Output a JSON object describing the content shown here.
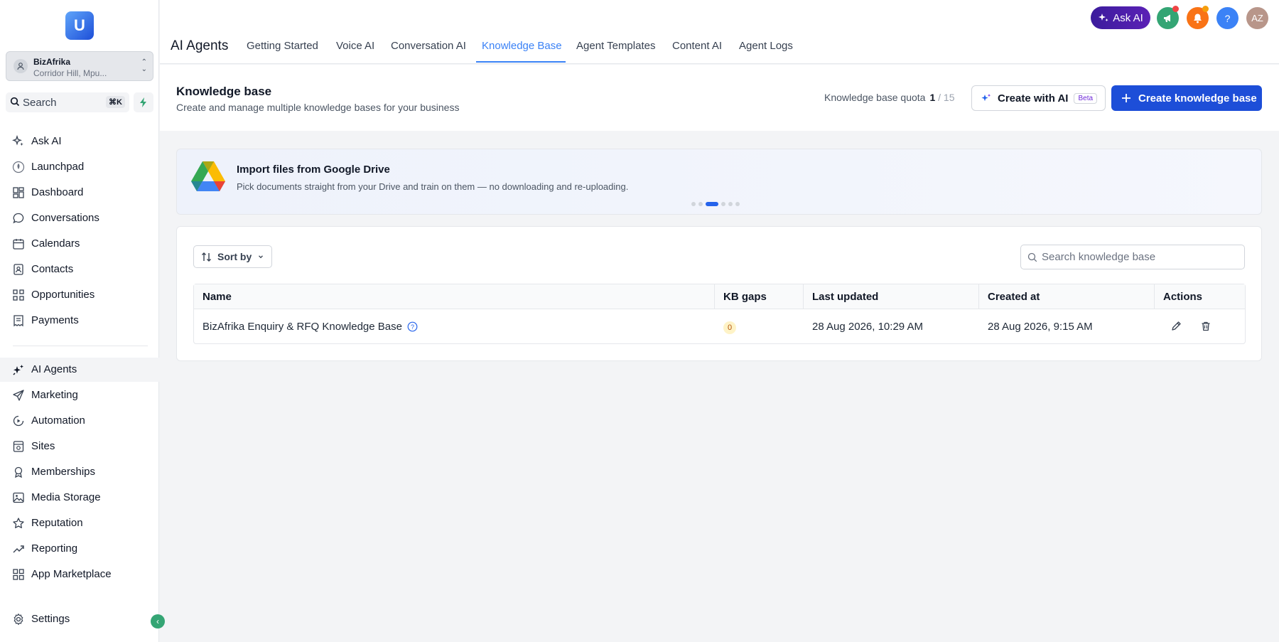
{
  "sidebar": {
    "logo_letter": "U",
    "account": {
      "name": "BizAfrika",
      "location": "Corridor Hill, Mpu..."
    },
    "search": {
      "label": "Search",
      "shortcut": "⌘K"
    },
    "items": [
      {
        "label": "Ask AI",
        "icon": "sparkles-icon"
      },
      {
        "label": "Launchpad",
        "icon": "rocket-icon"
      },
      {
        "label": "Dashboard",
        "icon": "dashboard-icon"
      },
      {
        "label": "Conversations",
        "icon": "chat-icon"
      },
      {
        "label": "Calendars",
        "icon": "calendar-icon"
      },
      {
        "label": "Contacts",
        "icon": "contacts-icon"
      },
      {
        "label": "Opportunities",
        "icon": "opportunities-icon"
      },
      {
        "label": "Payments",
        "icon": "payments-icon"
      },
      {
        "label": "AI Agents",
        "icon": "ai-agents-icon"
      },
      {
        "label": "Marketing",
        "icon": "send-icon"
      },
      {
        "label": "Automation",
        "icon": "automation-icon"
      },
      {
        "label": "Sites",
        "icon": "sites-icon"
      },
      {
        "label": "Memberships",
        "icon": "memberships-icon"
      },
      {
        "label": "Media Storage",
        "icon": "image-icon"
      },
      {
        "label": "Reputation",
        "icon": "star-icon"
      },
      {
        "label": "Reporting",
        "icon": "trend-icon"
      },
      {
        "label": "App Marketplace",
        "icon": "grid-icon"
      }
    ],
    "settings_label": "Settings"
  },
  "header": {
    "title": "AI Agents",
    "tabs": [
      "Getting Started",
      "Voice AI",
      "Conversation AI",
      "Knowledge Base",
      "Agent Templates",
      "Content AI",
      "Agent Logs"
    ],
    "active_tab": "Knowledge Base",
    "ask_ai_label": "Ask AI",
    "avatar_initials": "AZ",
    "colors": {
      "accent": "#3b82f6",
      "primary_button": "#1d4ed8",
      "ask_ai": "#4c1d95",
      "announce": "#34a574",
      "bell": "#f97316",
      "help": "#3b82f6",
      "avatar": "#b8968a"
    }
  },
  "page": {
    "title": "Knowledge base",
    "subtitle": "Create and manage multiple knowledge bases for your business",
    "quota_label": "Knowledge base quota",
    "quota_used": "1",
    "quota_total": "/ 15",
    "create_ai_label": "Create with AI",
    "beta_label": "Beta",
    "create_label": "Create knowledge base"
  },
  "banner": {
    "title": "Import files from Google Drive",
    "description": "Pick documents straight from your Drive and train on them — no downloading and re-uploading.",
    "page_count": 6,
    "active_page": 3
  },
  "table": {
    "sort_label": "Sort by",
    "search_placeholder": "Search knowledge base",
    "columns": [
      "Name",
      "KB gaps",
      "Last updated",
      "Created at",
      "Actions"
    ],
    "rows": [
      {
        "name": "BizAfrika Enquiry & RFQ Knowledge Base",
        "kb_gaps": "0",
        "last_updated": "28 Aug 2026, 10:29 AM",
        "created_at": "28 Aug 2026, 9:15 AM"
      }
    ]
  }
}
